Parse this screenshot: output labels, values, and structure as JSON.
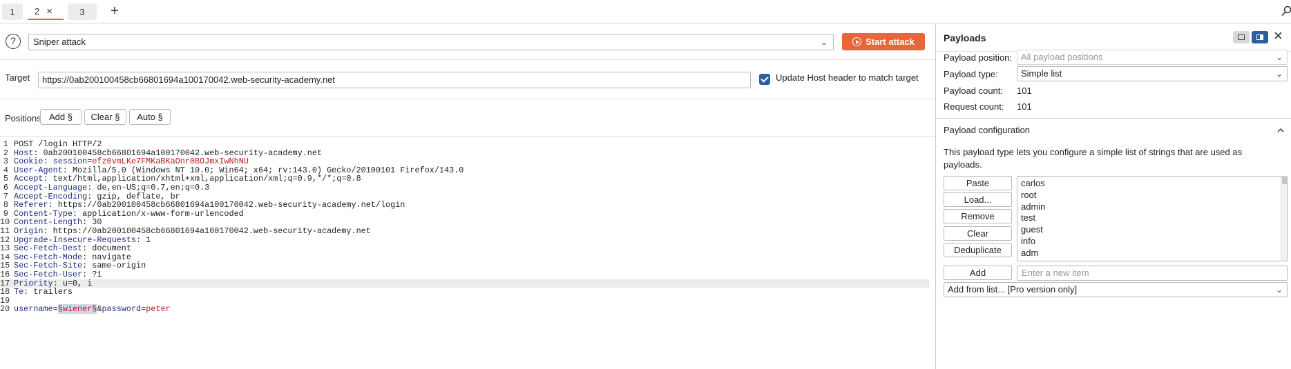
{
  "tabs": [
    {
      "label": "1"
    },
    {
      "label": "2",
      "active": true
    },
    {
      "label": "3"
    }
  ],
  "tab_close": "×",
  "tab_add": "+",
  "attack": {
    "help": "?",
    "type": "Sniper attack",
    "start_label": "Start attack"
  },
  "target": {
    "label": "Target",
    "value": "https://0ab200100458cb66801694a100170042.web-security-academy.net",
    "update_host_label": "Update Host header to match target",
    "update_host_checked": true
  },
  "positions": {
    "label": "Positions",
    "add": "Add §",
    "clear": "Clear §",
    "auto": "Auto §"
  },
  "request": {
    "lines": [
      {
        "n": "1",
        "text": "POST /login HTTP/2"
      },
      {
        "n": "2",
        "key": "Host",
        "val": " 0ab200100458cb66801694a100170042.web-security-academy.net"
      },
      {
        "n": "3",
        "key": "Cookie",
        "cookie_name": "session",
        "cookie_val": "efz0vmLKe7FMKaBKaOnr0BOJmxIwNhNU"
      },
      {
        "n": "4",
        "key": "User-Agent",
        "val": " Mozilla/5.0 (Windows NT 10.0; Win64; x64; rv:143.0) Gecko/20100101 Firefox/143.0"
      },
      {
        "n": "5",
        "key": "Accept",
        "val": " text/html,application/xhtml+xml,application/xml;q=0.9,*/*;q=0.8"
      },
      {
        "n": "6",
        "key": "Accept-Language",
        "val": " de,en-US;q=0.7,en;q=0.3"
      },
      {
        "n": "7",
        "key": "Accept-Encoding",
        "val": " gzip, deflate, br"
      },
      {
        "n": "8",
        "key": "Referer",
        "val": " https://0ab200100458cb66801694a100170042.web-security-academy.net/login"
      },
      {
        "n": "9",
        "key": "Content-Type",
        "val": " application/x-www-form-urlencoded"
      },
      {
        "n": "10",
        "key": "Content-Length",
        "val": " 30"
      },
      {
        "n": "11",
        "key": "Origin",
        "val": " https://0ab200100458cb66801694a100170042.web-security-academy.net"
      },
      {
        "n": "12",
        "key": "Upgrade-Insecure-Requests",
        "val": " 1"
      },
      {
        "n": "13",
        "key": "Sec-Fetch-Dest",
        "val": " document"
      },
      {
        "n": "14",
        "key": "Sec-Fetch-Mode",
        "val": " navigate"
      },
      {
        "n": "15",
        "key": "Sec-Fetch-Site",
        "val": " same-origin"
      },
      {
        "n": "16",
        "key": "Sec-Fetch-User",
        "val": " ?1"
      },
      {
        "n": "17",
        "key": "Priority",
        "val": " u=0, i",
        "highlight": true
      },
      {
        "n": "18",
        "key": "Te",
        "val": " trailers"
      },
      {
        "n": "19",
        "text": ""
      },
      {
        "n": "20",
        "body": true
      }
    ],
    "body": {
      "p1_name": "username",
      "eq1": "=",
      "marked": "§wiener§",
      "amp": "&",
      "p2_name": "password",
      "eq2": "=",
      "p2_val": "peter"
    }
  },
  "payloads": {
    "title": "Payloads",
    "position_label": "Payload position:",
    "position_value": "All payload positions",
    "type_label": "Payload type:",
    "type_value": "Simple list",
    "count_label": "Payload count:",
    "count_value": "101",
    "request_count_label": "Request count:",
    "request_count_value": "101"
  },
  "config": {
    "title": "Payload configuration",
    "description": "This payload type lets you configure a simple list of strings that are used as payloads.",
    "buttons": {
      "paste": "Paste",
      "load": "Load...",
      "remove": "Remove",
      "clear": "Clear",
      "dedup": "Deduplicate",
      "add": "Add"
    },
    "items": [
      "carlos",
      "root",
      "admin",
      "test",
      "guest",
      "info",
      "adm"
    ],
    "new_item_placeholder": "Enter a new item",
    "add_from_list": "Add from list... [Pro version only]"
  },
  "colors": {
    "accent": "#e8663c",
    "checkbox": "#2c5f9e",
    "header_key": "#1f2f80",
    "value_red": "#b71c1c"
  }
}
